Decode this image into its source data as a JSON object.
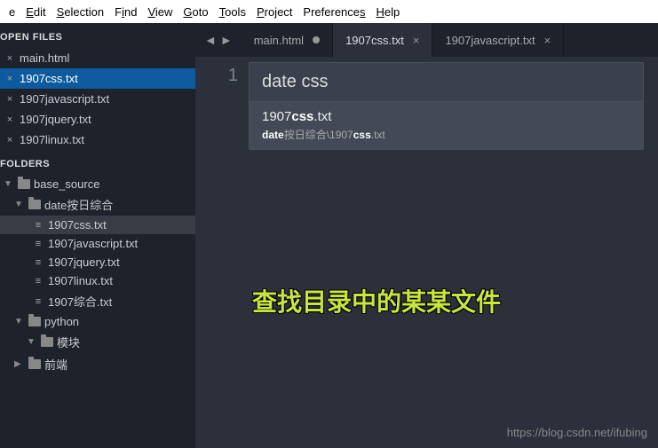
{
  "menu": [
    "e",
    "Edit",
    "Selection",
    "Find",
    "View",
    "Goto",
    "Tools",
    "Project",
    "Preferences",
    "Help"
  ],
  "sidebar": {
    "open_files_header": "OPEN FILES",
    "open_files": [
      {
        "name": "main.html",
        "active": false
      },
      {
        "name": "1907css.txt",
        "active": true
      },
      {
        "name": "1907javascript.txt",
        "active": false
      },
      {
        "name": "1907jquery.txt",
        "active": false
      },
      {
        "name": "1907linux.txt",
        "active": false
      }
    ],
    "folders_header": "FOLDERS",
    "tree": {
      "root": "base_source",
      "folder1": "date按日综合",
      "files": [
        {
          "name": "1907css.txt",
          "selected": true
        },
        {
          "name": "1907javascript.txt",
          "selected": false
        },
        {
          "name": "1907jquery.txt",
          "selected": false
        },
        {
          "name": "1907linux.txt",
          "selected": false
        },
        {
          "name": "1907综合.txt",
          "selected": false
        }
      ],
      "folder2": "python",
      "folder2_child": "模块",
      "folder3": "前端"
    }
  },
  "tabs": [
    {
      "label": "main.html",
      "active": false,
      "dirty": true
    },
    {
      "label": "1907css.txt",
      "active": true,
      "dirty": false
    },
    {
      "label": "1907javascript.txt",
      "active": false,
      "dirty": false
    }
  ],
  "gutter": {
    "line1": "1"
  },
  "search": {
    "query": "date css",
    "result_name_pre": "1907",
    "result_name_bold": "css",
    "result_name_post": ".txt",
    "result_path_bold1": "date",
    "result_path_mid": "按日综合\\1907",
    "result_path_bold2": "css",
    "result_path_post": ".txt"
  },
  "annotation": "查找目录中的某某文件",
  "watermark": "https://blog.csdn.net/ifubing"
}
